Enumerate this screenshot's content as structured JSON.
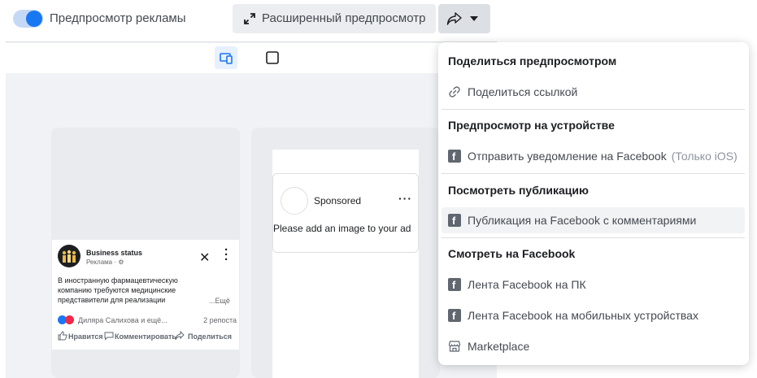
{
  "header": {
    "toggle_label": "Предпросмотр рекламы",
    "expand_label": "Расширенный предпросмотр",
    "share_icon": "share-icon"
  },
  "mobile_ad": {
    "business_name": "Business status",
    "subtitle": "Реклама · ⚙",
    "text": "В иностранную фармацевтическую компанию требуются медицинские представители для реализации",
    "more": "...Ещё",
    "reactions_names": "Диляра Салихова и ещё...",
    "shares": "2 репоста",
    "like": "Нравится",
    "comment": "Комментировать",
    "share": "Поделиться"
  },
  "desktop_ad": {
    "sponsored": "Sponsored",
    "placeholder": "Please add an image to your ad"
  },
  "menu": {
    "section1": "Поделиться предпросмотром",
    "share_link": "Поделиться ссылкой",
    "section2": "Предпросмотр на устройстве",
    "send_notification": "Отправить уведомление на Facebook",
    "ios_only": "(Только iOS)",
    "section3": "Посмотреть публикацию",
    "post_with_comments": "Публикация на Facebook с комментариями",
    "section4": "Смотреть на Facebook",
    "feed_desktop": "Лента Facebook на ПК",
    "feed_mobile": "Лента Facebook на мобильных устройствах",
    "marketplace": "Marketplace"
  },
  "colors": {
    "accent": "#1877f2",
    "toggle_track": "#c5d9f7"
  }
}
